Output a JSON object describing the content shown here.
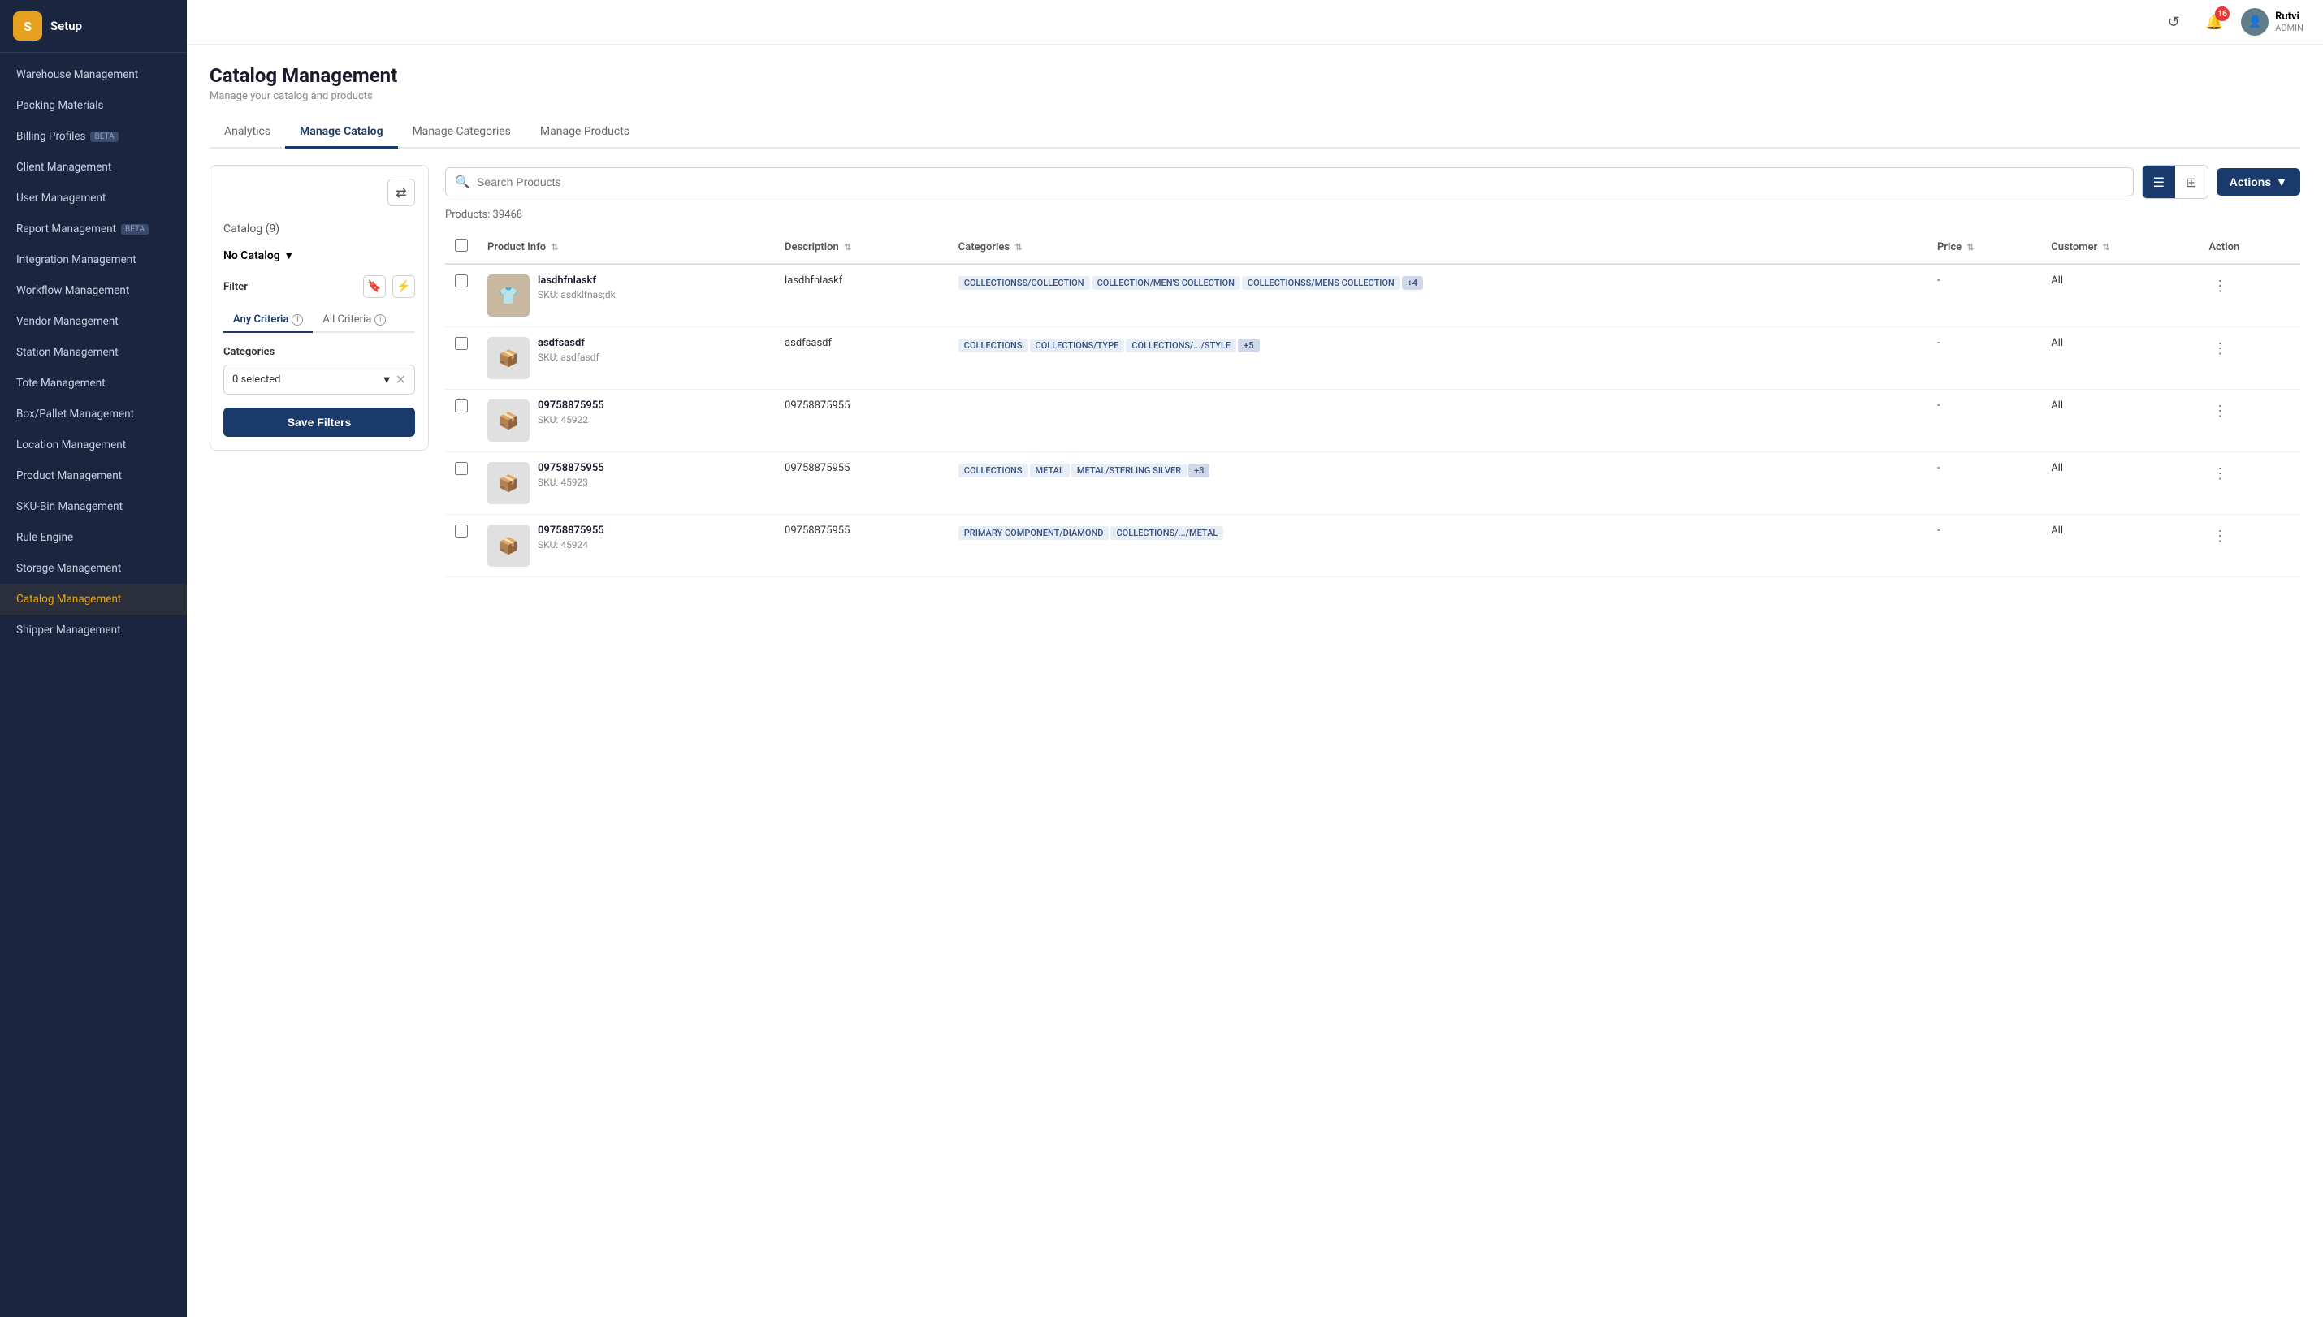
{
  "app": {
    "logo_text": "S",
    "title": "Setup"
  },
  "sidebar": {
    "items": [
      {
        "label": "Warehouse Management",
        "active": false
      },
      {
        "label": "Packing Materials",
        "active": false
      },
      {
        "label": "Billing Profiles",
        "active": false,
        "badge": "BETA"
      },
      {
        "label": "Client Management",
        "active": false
      },
      {
        "label": "User Management",
        "active": false
      },
      {
        "label": "Report Management",
        "active": false,
        "badge": "BETA"
      },
      {
        "label": "Integration Management",
        "active": false
      },
      {
        "label": "Workflow Management",
        "active": false
      },
      {
        "label": "Vendor Management",
        "active": false
      },
      {
        "label": "Station Management",
        "active": false
      },
      {
        "label": "Tote Management",
        "active": false
      },
      {
        "label": "Box/Pallet Management",
        "active": false
      },
      {
        "label": "Location Management",
        "active": false
      },
      {
        "label": "Product Management",
        "active": false
      },
      {
        "label": "SKU-Bin Management",
        "active": false
      },
      {
        "label": "Rule Engine",
        "active": false
      },
      {
        "label": "Storage Management",
        "active": false
      },
      {
        "label": "Catalog Management",
        "active": true
      },
      {
        "label": "Shipper Management",
        "active": false
      }
    ]
  },
  "topbar": {
    "notifications_count": "16",
    "user_name": "Rutvi",
    "user_role": "ADMIN"
  },
  "page": {
    "title": "Catalog Management",
    "subtitle": "Manage your catalog and products"
  },
  "tabs": [
    {
      "label": "Analytics",
      "active": false
    },
    {
      "label": "Manage Catalog",
      "active": true
    },
    {
      "label": "Manage Categories",
      "active": false
    },
    {
      "label": "Manage Products",
      "active": false
    }
  ],
  "filter_panel": {
    "catalog_count": "Catalog (9)",
    "catalog_selected": "No Catalog",
    "filter_label": "Filter",
    "criteria_tabs": [
      {
        "label": "Any Criteria",
        "active": true
      },
      {
        "label": "All Criteria",
        "active": false
      }
    ],
    "categories_label": "Categories",
    "categories_selected": "0 selected",
    "save_filters_label": "Save Filters"
  },
  "product_panel": {
    "search_placeholder": "Search Products",
    "products_count": "Products: 39468",
    "actions_label": "Actions",
    "columns": [
      {
        "label": "Product Info",
        "sortable": true
      },
      {
        "label": "Description",
        "sortable": true
      },
      {
        "label": "Categories",
        "sortable": true
      },
      {
        "label": "Price",
        "sortable": true
      },
      {
        "label": "Customer",
        "sortable": true
      },
      {
        "label": "Action",
        "sortable": false
      }
    ],
    "products": [
      {
        "id": 1,
        "name": "lasdhfnlaskf",
        "sku": "asdklfnas;dk",
        "description": "lasdhfnlaskf",
        "categories": [
          "COLLECTIONSS/COLLECTION",
          "COLLECTION/MEN'S COLLECTION",
          "COLLECTIONSS/MENS COLLECTION"
        ],
        "more": "+4",
        "price": "-",
        "customer": "All",
        "has_image": true
      },
      {
        "id": 2,
        "name": "asdfsasdf",
        "sku": "asdfasdf",
        "description": "asdfsasdf",
        "categories": [
          "COLLECTIONS",
          "COLLECTIONS/TYPE",
          "COLLECTIONS/.../STYLE"
        ],
        "more": "+5",
        "price": "-",
        "customer": "All",
        "has_image": false
      },
      {
        "id": 3,
        "name": "09758875955",
        "sku": "45922",
        "description": "09758875955",
        "categories": [],
        "more": "",
        "price": "-",
        "customer": "All",
        "has_image": false
      },
      {
        "id": 4,
        "name": "09758875955",
        "sku": "45923",
        "description": "09758875955",
        "categories": [
          "COLLECTIONS",
          "METAL",
          "METAL/STERLING SILVER"
        ],
        "more": "+3",
        "price": "-",
        "customer": "All",
        "has_image": false
      },
      {
        "id": 5,
        "name": "09758875955",
        "sku": "45924",
        "description": "09758875955",
        "categories": [
          "PRIMARY COMPONENT/DIAMOND",
          "COLLECTIONS/.../METAL"
        ],
        "more": "",
        "price": "-",
        "customer": "All",
        "has_image": false
      }
    ]
  }
}
